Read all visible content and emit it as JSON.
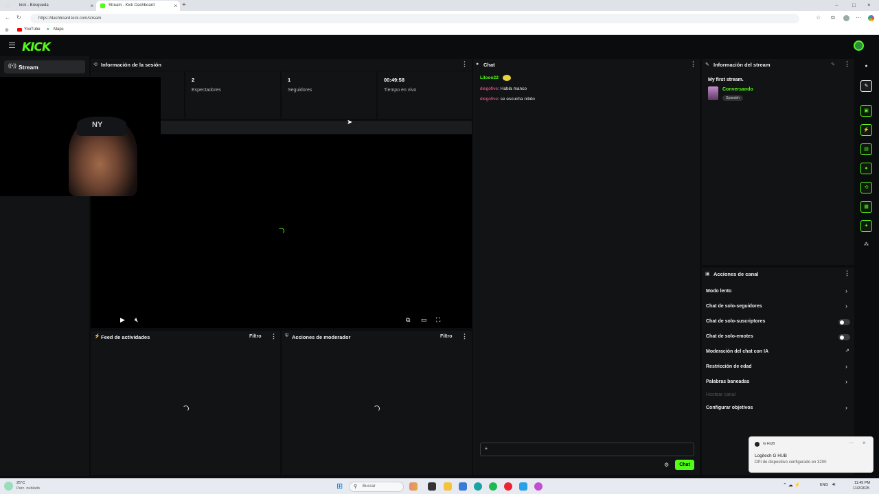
{
  "browser": {
    "tabs": [
      {
        "label": "kick - Búsqueda"
      },
      {
        "label": "Stream - Kick Dashboard"
      }
    ],
    "url": "https://dashboard.kick.com/stream",
    "bookmarks": [
      "YouTube",
      "Maps"
    ]
  },
  "app": {
    "logo": "KICK",
    "sidebar": {
      "items": [
        {
          "label": "Stream"
        }
      ]
    }
  },
  "session": {
    "title": "Información de la sesión",
    "stats": [
      {
        "value": "2",
        "label": "Espectadores"
      },
      {
        "value": "1",
        "label": "Seguidores"
      },
      {
        "value": "00:49:58",
        "label": "Tiempo en vivo"
      }
    ]
  },
  "feed": {
    "title": "Feed de actividades",
    "filter": "Filtro"
  },
  "moderator": {
    "title": "Acciones de moderador",
    "filter": "Filtro"
  },
  "chat": {
    "title": "Chat",
    "messages": [
      {
        "user": "Lilooo22",
        "text": "",
        "user_color": "#53fc18"
      },
      {
        "user": "diegofive",
        "text": "Habla manco",
        "user_color": "#ff5fa2"
      },
      {
        "user": "diegofive",
        "text": "se escucha nitido",
        "user_color": "#ff5fa2"
      }
    ],
    "send_label": "Chat"
  },
  "stream_info": {
    "title": "Información del stream",
    "stream_title": "My first stream.",
    "category": "Conversando",
    "language": "Spanish"
  },
  "channel_actions": {
    "title": "Acciones de canal",
    "items": [
      {
        "label": "Modo lento",
        "control": "chevron"
      },
      {
        "label": "Chat de solo-seguidores",
        "control": "chevron"
      },
      {
        "label": "Chat de solo-suscriptores",
        "control": "toggle"
      },
      {
        "label": "Chat de solo-emotes",
        "control": "toggle"
      },
      {
        "label": "Moderación del chat con IA",
        "control": "external"
      },
      {
        "label": "Restricción de edad",
        "control": "chevron"
      },
      {
        "label": "Palabras baneadas",
        "control": "chevron"
      },
      {
        "label": "Hostear canal",
        "control": "disabled"
      },
      {
        "label": "Configurar objetivos",
        "control": "chevron"
      }
    ]
  },
  "toast": {
    "app": "G HUB",
    "title": "Logitech G HUB",
    "body": "DPI de dispositivo configurado en 3200"
  },
  "taskbar": {
    "weather_temp": "25°C",
    "weather_desc": "Parc. nublado",
    "search": "Buscar",
    "lang": "ENG",
    "time": "11:45 PM",
    "date": "11/2/2025"
  },
  "colors": {
    "accent": "#53fc18",
    "bg": "#0b0c0d",
    "panel": "#121315"
  }
}
